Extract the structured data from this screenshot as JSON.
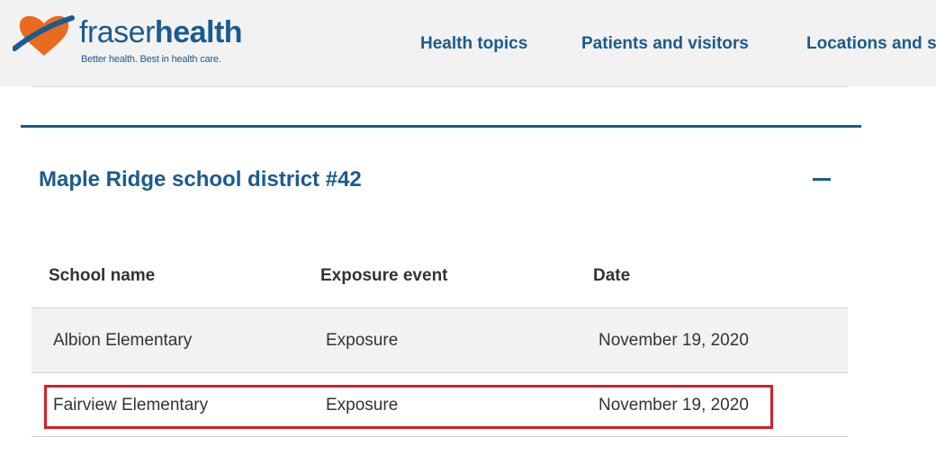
{
  "brand": {
    "name_light": "fraser",
    "name_bold": "health",
    "tagline": "Better health. Best in health care.",
    "colors": {
      "primary": "#1b5b8f",
      "accent": "#e86b1f",
      "highlight": "#d12027"
    }
  },
  "nav": {
    "items": [
      {
        "label": "Health topics"
      },
      {
        "label": "Patients and visitors"
      },
      {
        "label": "Locations and s"
      }
    ]
  },
  "section": {
    "title": "Maple Ridge school district #42",
    "toggle_icon": "minus-icon"
  },
  "table": {
    "headers": [
      "School name",
      "Exposure event",
      "Date"
    ],
    "rows": [
      {
        "school": "Albion Elementary",
        "event": "Exposure",
        "date": "November 19, 2020"
      },
      {
        "school": "Fairview Elementary",
        "event": "Exposure",
        "date": "November 19, 2020"
      }
    ]
  }
}
